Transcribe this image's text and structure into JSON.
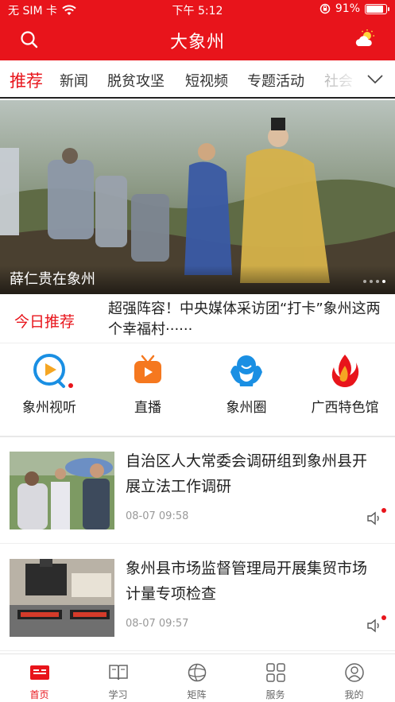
{
  "status_bar": {
    "carrier": "无 SIM 卡",
    "time": "下午 5:12",
    "battery": "91%",
    "battery_level": 0.91
  },
  "header": {
    "title": "大象州"
  },
  "tabs": [
    {
      "label": "推荐",
      "active": true
    },
    {
      "label": "新闻"
    },
    {
      "label": "脱贫攻坚"
    },
    {
      "label": "短视频"
    },
    {
      "label": "专题活动"
    },
    {
      "label": "社会"
    }
  ],
  "hero": {
    "caption": "薛仁贵在象州",
    "slide_count": 4,
    "active_slide": 3
  },
  "today": {
    "label": "今日推荐",
    "text": "超强阵容！中央媒体采访团“打卡”象州这两个幸福村······"
  },
  "shortcuts": [
    {
      "label": "象州视听",
      "icon": "play-circle-icon",
      "badge": true
    },
    {
      "label": "直播",
      "icon": "tv-icon"
    },
    {
      "label": "象州圈",
      "icon": "people-icon"
    },
    {
      "label": "广西特色馆",
      "icon": "flame-icon"
    }
  ],
  "news": [
    {
      "headline": "自治区人大常委会调研组到象州县开展立法工作调研",
      "date": "08-07 09:58"
    },
    {
      "headline": "象州县市场监督管理局开展集贸市场计量专项检查",
      "date": "08-07 09:57"
    }
  ],
  "bottom_nav": [
    {
      "label": "首页",
      "active": true
    },
    {
      "label": "学习"
    },
    {
      "label": "矩阵"
    },
    {
      "label": "服务"
    },
    {
      "label": "我的"
    }
  ],
  "colors": {
    "brand": "#e8141b",
    "text": "#222222",
    "muted": "#999999"
  }
}
